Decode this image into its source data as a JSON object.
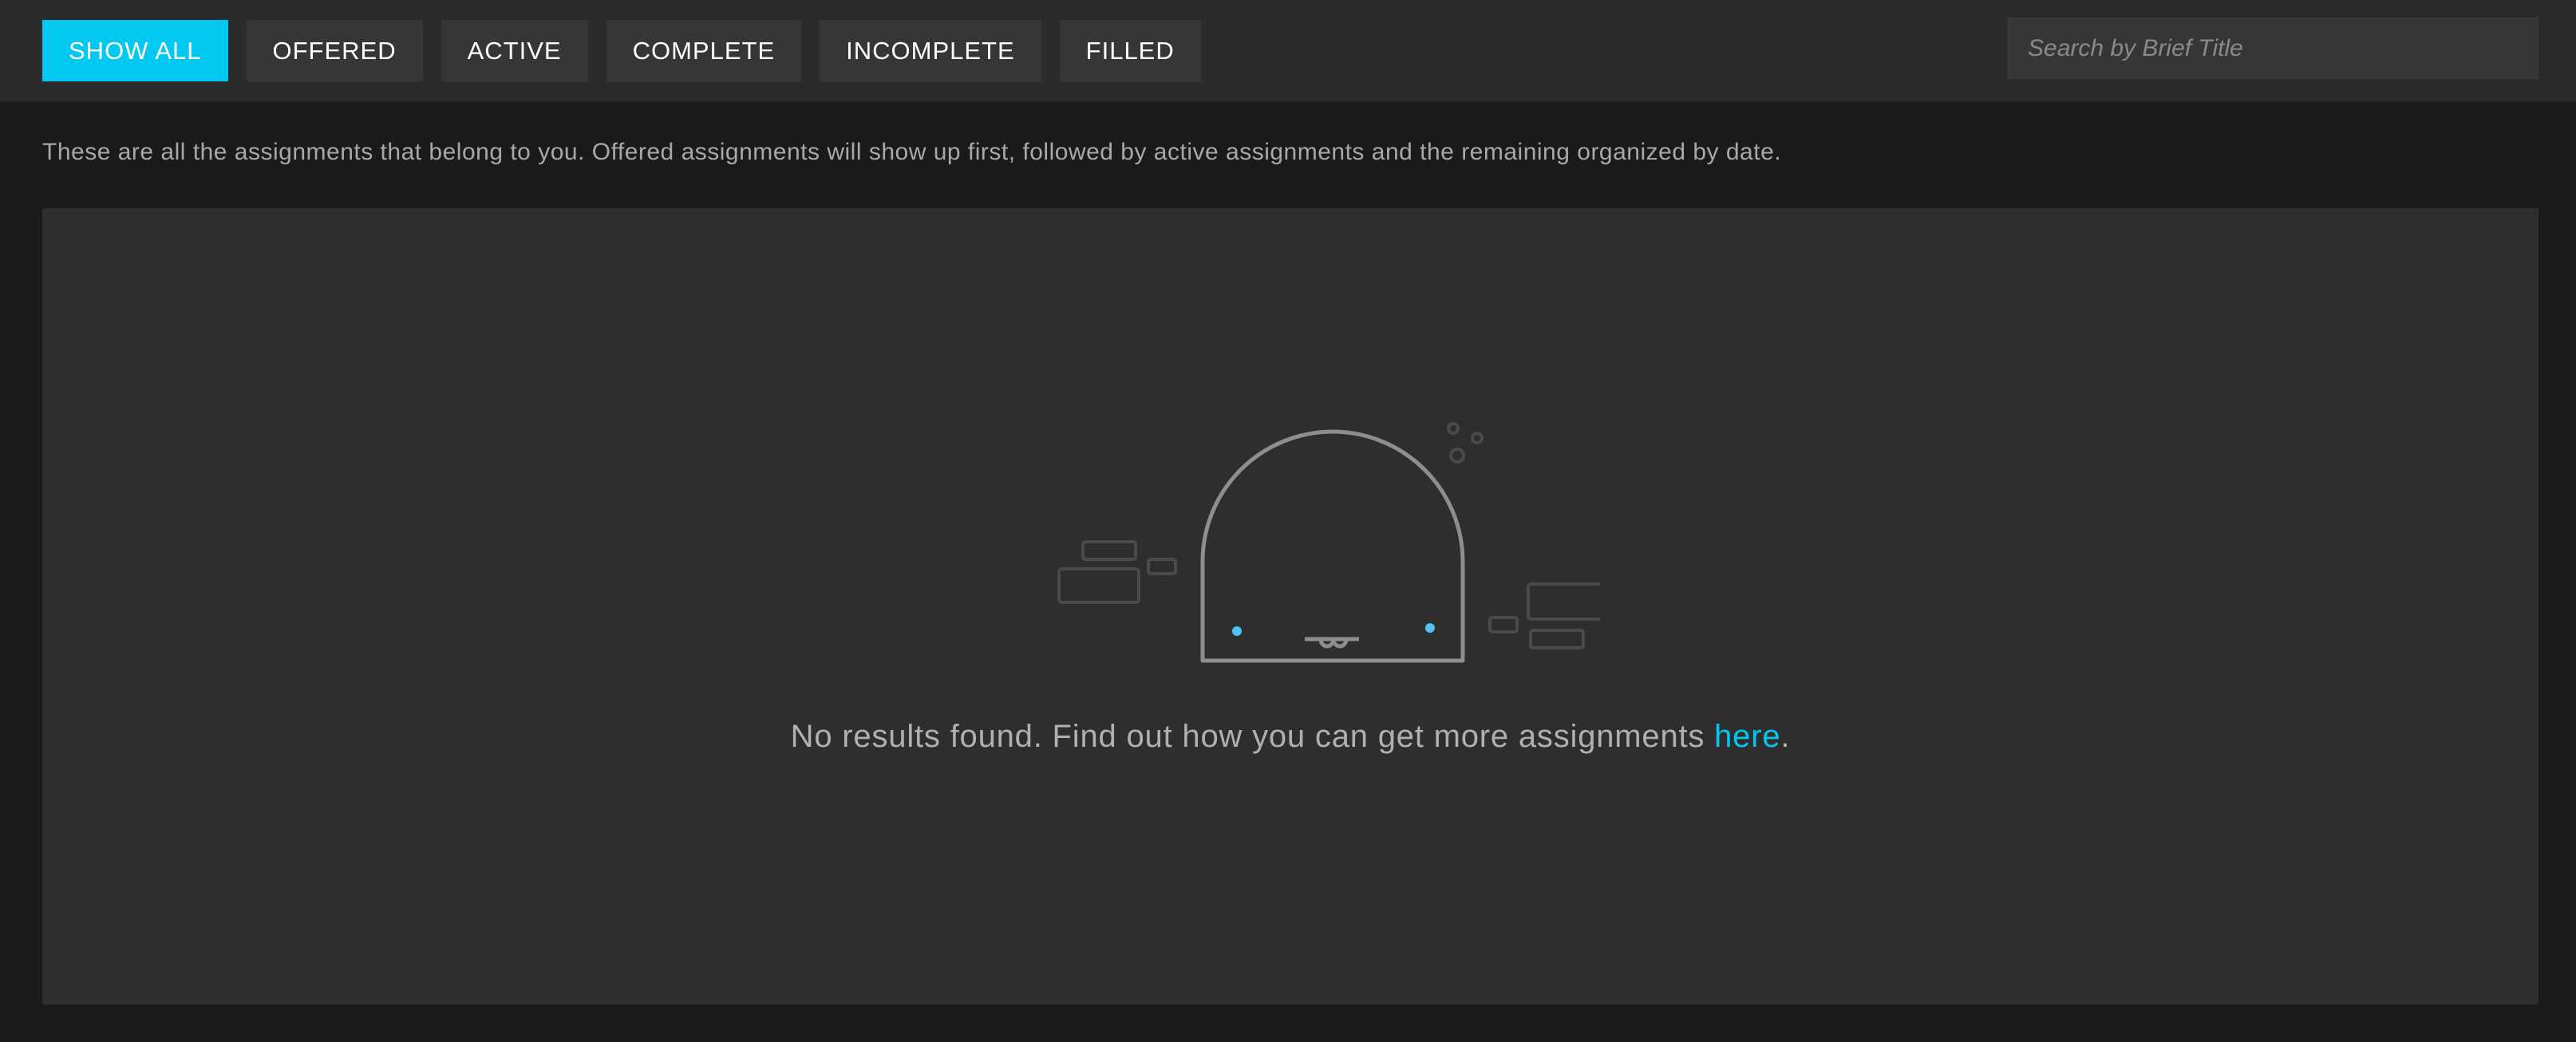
{
  "filters": [
    {
      "label": "SHOW ALL",
      "active": true
    },
    {
      "label": "OFFERED",
      "active": false
    },
    {
      "label": "ACTIVE",
      "active": false
    },
    {
      "label": "COMPLETE",
      "active": false
    },
    {
      "label": "INCOMPLETE",
      "active": false
    },
    {
      "label": "FILLED",
      "active": false
    }
  ],
  "search": {
    "placeholder": "Search by Brief Title",
    "value": ""
  },
  "intro_text": "These are all the assignments that belong to you. Offered assignments will show up first, followed by active assignments and the remaining organized by date.",
  "empty_state": {
    "illustration_icon": "sleepy-ghost-icon",
    "message": "No results found. Find out how you can get more assignments ",
    "link_text": "here",
    "suffix": "."
  },
  "colors": {
    "accent": "#00c8f0",
    "background": "#1a1a1a",
    "topbar": "#2b2b2b",
    "panel": "#2e2e2e",
    "button": "#363636"
  }
}
